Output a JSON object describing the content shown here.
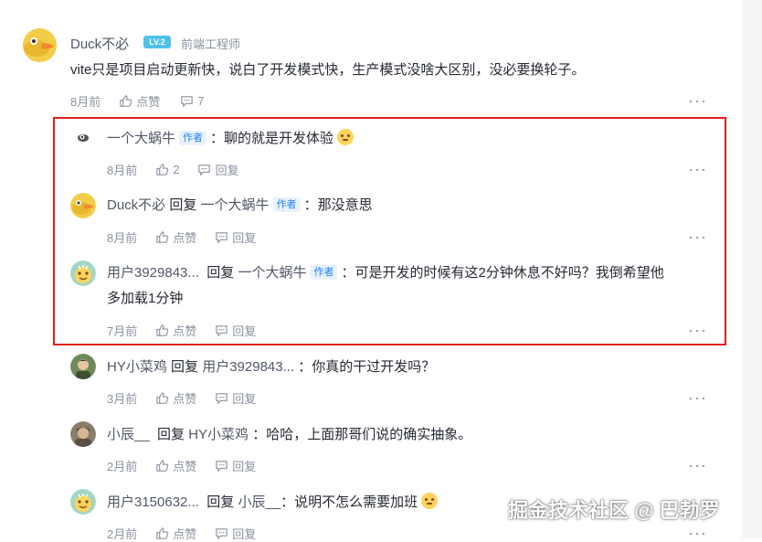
{
  "comments": [
    {
      "name": "Duck不必",
      "level": "LV.2",
      "title": "前端工程师",
      "content": "vite只是项目启动更新快，说白了开发模式快，生产模式没啥大区别，没必要换轮子。",
      "time": "8月前",
      "like": "点赞",
      "reply": "7"
    }
  ],
  "replies": [
    {
      "name": "一个大蜗牛",
      "reply_word": "",
      "target": "",
      "author_tag": "作者",
      "content": "：聊的就是开发体验",
      "emoji": "thinking-emoji",
      "time": "8月前",
      "like": "2",
      "reply": "回复"
    },
    {
      "name": "Duck不必",
      "reply_word": "回复",
      "target": "一个大蜗牛",
      "author_tag": "作者",
      "content": "：那没意思",
      "time": "8月前",
      "like": "点赞",
      "reply": "回复"
    },
    {
      "name": "用户3929843...",
      "reply_word": "回复",
      "target": "一个大蜗牛",
      "author_tag": "作者",
      "content": "：可是开发的时候有这2分钟休息不好吗？我倒希望他",
      "content2": "多加载1分钟",
      "time": "7月前",
      "like": "点赞",
      "reply": "回复"
    },
    {
      "name": "HY小菜鸡",
      "reply_word": "回复",
      "target": "用户3929843...",
      "content": "：你真的干过开发吗？",
      "time": "3月前",
      "like": "点赞",
      "reply": "回复"
    },
    {
      "name": "小辰__",
      "reply_word": "回复",
      "target": "HY小菜鸡",
      "content": "：哈哈，上面那哥们说的确实抽象。",
      "time": "2月前",
      "like": "点赞",
      "reply": "回复"
    },
    {
      "name": "用户3150632...",
      "reply_word": "回复",
      "target": "小辰__",
      "content": "：说明不怎么需要加班",
      "emoji": "smile-emoji",
      "time": "2月前",
      "like": "点赞",
      "reply": "回复"
    }
  ],
  "more_icon": "···",
  "watermark": "掘金技术社区 @ 巴勃罗",
  "colors": {
    "accent": "#1e80ff",
    "highlight_box": "#e02020",
    "meta": "#8a919f"
  }
}
